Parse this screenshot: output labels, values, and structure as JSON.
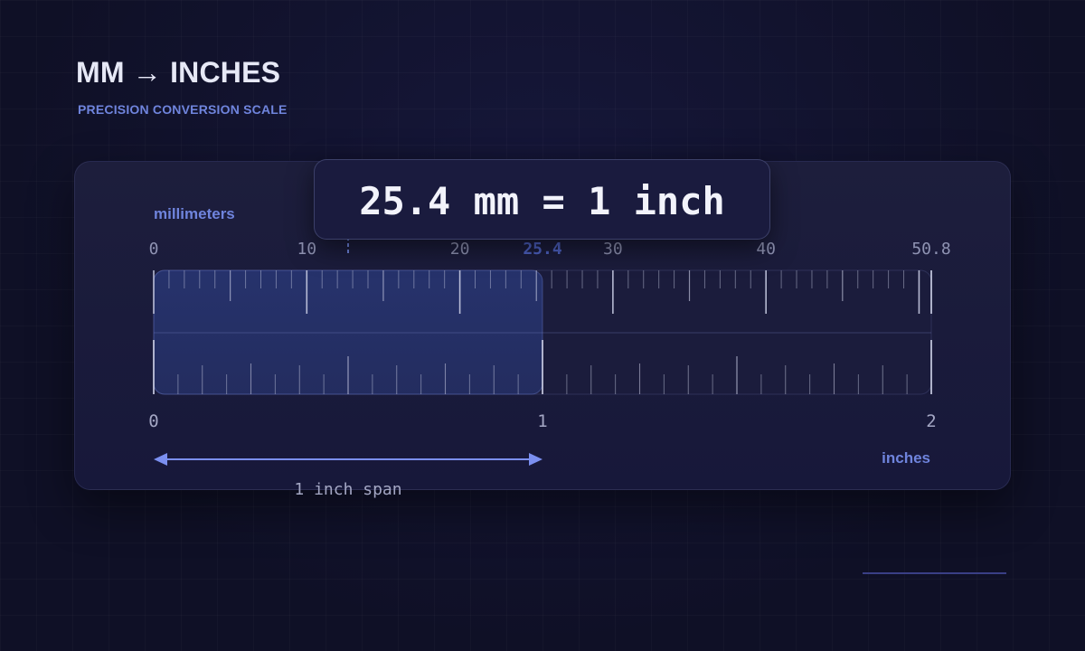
{
  "title": "MM → INCHES",
  "subtitle": "PRECISION CONVERSION SCALE",
  "callout": "25.4 mm = 1 inch",
  "mm_scale": {
    "label": "millimeters",
    "max": 50.8,
    "tick_labels": [
      "0",
      "10",
      "20",
      "30",
      "40",
      "50.8"
    ],
    "highlight_label": "25.4"
  },
  "inch_scale": {
    "label": "inches",
    "max": 2,
    "tick_labels": [
      "0",
      "1",
      "2"
    ]
  },
  "span": {
    "label": "1 inch span",
    "from_in": 0,
    "to_in": 1
  },
  "colors": {
    "accent": "#6f84dd",
    "highlight": "#4e62c4",
    "tick": "#c8cbe2",
    "label": "#8f93b3"
  }
}
